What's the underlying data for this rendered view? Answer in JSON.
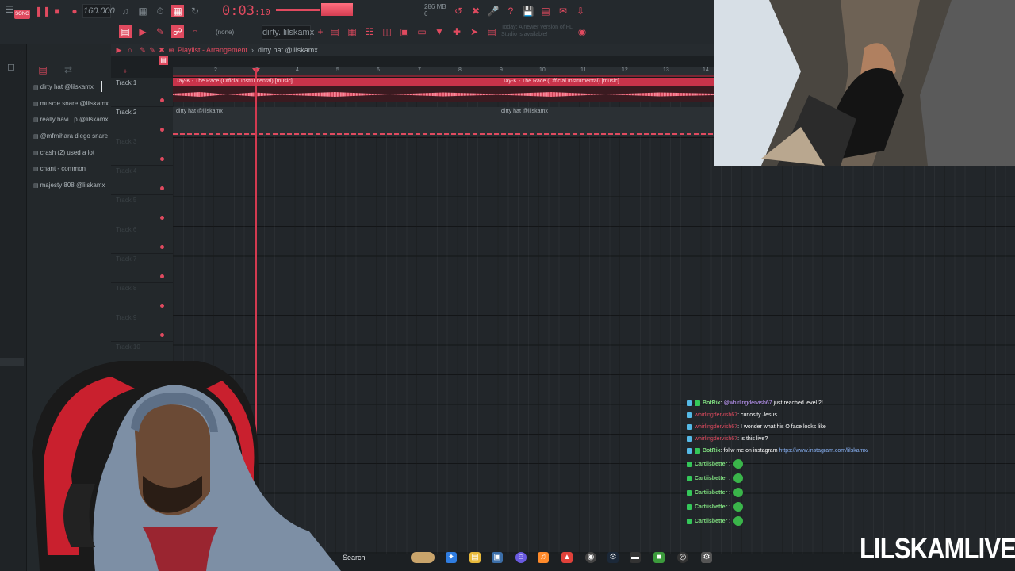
{
  "toolbar": {
    "mode_label": "SONG",
    "bpm": "160.000",
    "time": "0:03",
    "time_ticks": "10",
    "cpu_label": "286 MB",
    "cpu_value": "6",
    "snap_label": "(none)",
    "pattern_name": "dirty..lilskamx",
    "update_hint": "Today: A newer version of FL Studio is available!"
  },
  "playlist": {
    "title_prefix": "Playlist - Arrangement",
    "title_pattern": "dirty hat @lilskamx",
    "bar_numbers": [
      "2",
      "3",
      "4",
      "5",
      "6",
      "7",
      "8",
      "9",
      "10",
      "11",
      "12",
      "13",
      "14"
    ]
  },
  "channels": [
    {
      "label": "dirty hat @lilskamx"
    },
    {
      "label": "muscle snare @lilskamx"
    },
    {
      "label": "really havi...p @lilskamx"
    },
    {
      "label": "@mfmihara diego snare"
    },
    {
      "label": "crash (2) used a lot"
    },
    {
      "label": "chant - common"
    },
    {
      "label": "majesty 808 @lilskamx"
    }
  ],
  "tracks": [
    {
      "name": "Track 1"
    },
    {
      "name": "Track 2"
    },
    {
      "name": "Track 3"
    },
    {
      "name": "Track 4"
    },
    {
      "name": "Track 5"
    },
    {
      "name": "Track 6"
    },
    {
      "name": "Track 7"
    },
    {
      "name": "Track 8"
    },
    {
      "name": "Track 9"
    },
    {
      "name": "Track 10"
    }
  ],
  "clips": {
    "audio_label": "Tay-K - The Race (Official Instrumental) [music]",
    "pattern_label": "dirty hat @lilskamx"
  },
  "chat": [
    {
      "user": "BotRix",
      "mention": "@whirlingdervish67",
      "text": " just reached level 2!"
    },
    {
      "user": "whirlingdervish67",
      "text": ": curiosity Jesus"
    },
    {
      "user": "whirlingdervish67",
      "text": ": I wonder what his O face looks like"
    },
    {
      "user": "whirlingdervish67",
      "text": ": is this live?"
    },
    {
      "user": "BotRix",
      "text": ": follw me on instagram ",
      "link": "https://www.instagram.com/lilskamx/"
    },
    {
      "user": "Cartiisbetter",
      "text": " :"
    },
    {
      "user": "Cartiisbetter",
      "text": " :"
    },
    {
      "user": "Cartiisbetter",
      "text": " :"
    },
    {
      "user": "Cartiisbetter",
      "text": " :"
    },
    {
      "user": "Cartiisbetter",
      "text": " :"
    }
  ],
  "taskbar": {
    "search_label": "Search"
  },
  "brand": "LILSKAMLIVE",
  "colors": {
    "accent": "#e04a5f",
    "background": "#1c2023",
    "chat_user": "#7fdc7f"
  }
}
